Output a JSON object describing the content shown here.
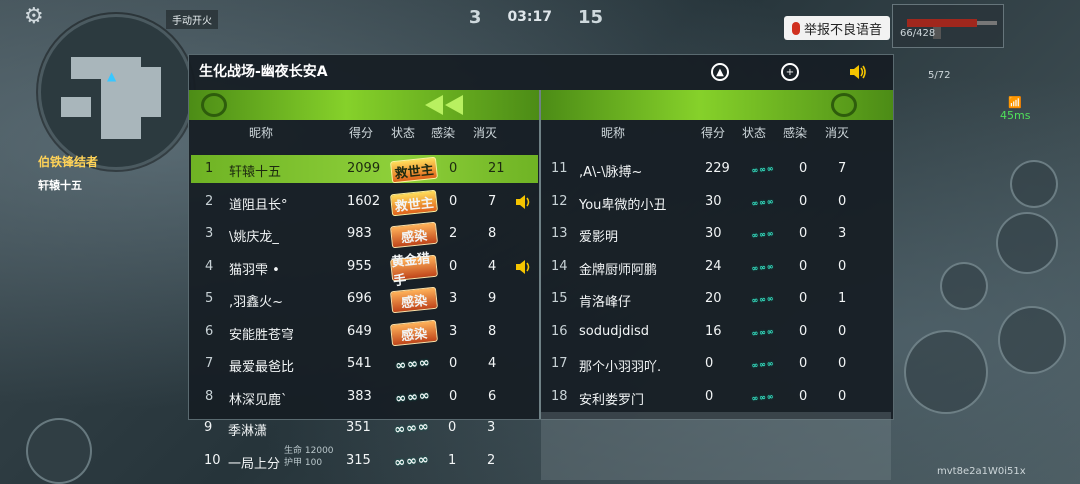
{
  "hud": {
    "auto_fire": "手动开火",
    "score_left": "3",
    "timer": "03:17",
    "score_right": "15",
    "report_label": "举报不良语音",
    "ammo_main": "66/428",
    "ammo_secondary": "5/72",
    "ping": "45ms",
    "hp_label": "生命",
    "armor_label": "护甲",
    "hp_value": "12000",
    "armor_value": "100",
    "uid": "mvt8e2a1W0i51x",
    "left_names": [
      "伯铁锋结者",
      "轩辕十五"
    ]
  },
  "board": {
    "title": "生化战场-幽夜长安A",
    "headers": {
      "name": "昵称",
      "score": "得分",
      "status": "状态",
      "infect": "感染",
      "kill": "消灭"
    },
    "left_rows": [
      {
        "num": "1",
        "name": "轩辕十五",
        "score": "2099",
        "badge": "救世主",
        "infect": "0",
        "kill": "21",
        "highlight": true,
        "speaker": false
      },
      {
        "num": "2",
        "name": "道阻且长°",
        "score": "1602",
        "badge": "救世主",
        "infect": "0",
        "kill": "7",
        "highlight": false,
        "speaker": true
      },
      {
        "num": "3",
        "name": "\\姚庆龙_",
        "score": "983",
        "badge": "感染",
        "infect": "2",
        "kill": "8",
        "highlight": false,
        "speaker": false
      },
      {
        "num": "4",
        "name": "猫羽雫 •",
        "score": "955",
        "badge": "黄金猎手",
        "infect": "0",
        "kill": "4",
        "highlight": false,
        "speaker": true
      },
      {
        "num": "5",
        "name": ",羽鑫火~",
        "score": "696",
        "badge": "感染",
        "infect": "3",
        "kill": "9",
        "highlight": false,
        "speaker": false
      },
      {
        "num": "6",
        "name": "安能胜苍穹",
        "score": "649",
        "badge": "感染",
        "infect": "3",
        "kill": "8",
        "highlight": false,
        "speaker": false
      },
      {
        "num": "7",
        "name": "最爱最爸比",
        "score": "541",
        "badge": "幽灵",
        "infect": "0",
        "kill": "4",
        "highlight": false,
        "speaker": false
      },
      {
        "num": "8",
        "name": "林深见鹿`",
        "score": "383",
        "badge": "幽灵",
        "infect": "0",
        "kill": "6",
        "highlight": false,
        "speaker": false
      },
      {
        "num": "9",
        "name": "季淋潇",
        "score": "351",
        "badge": "幽灵",
        "infect": "0",
        "kill": "3",
        "highlight": false,
        "speaker": false
      },
      {
        "num": "10",
        "name": "一局上分",
        "score": "315",
        "badge": "幽灵",
        "infect": "1",
        "kill": "2",
        "highlight": false,
        "speaker": false
      }
    ],
    "right_rows": [
      {
        "num": "11",
        "name": ",A\\-\\脉搏~",
        "score": "229",
        "badge": "幽灵",
        "infect": "0",
        "kill": "7"
      },
      {
        "num": "12",
        "name": "You卑微的小丑",
        "score": "30",
        "badge": "幽灵",
        "infect": "0",
        "kill": "0"
      },
      {
        "num": "13",
        "name": "爱影明",
        "score": "30",
        "badge": "幽灵",
        "infect": "0",
        "kill": "3"
      },
      {
        "num": "14",
        "name": "金牌厨师阿鹏",
        "score": "24",
        "badge": "幽灵",
        "infect": "0",
        "kill": "0"
      },
      {
        "num": "15",
        "name": "肯洛峰仔",
        "score": "20",
        "badge": "幽灵",
        "infect": "0",
        "kill": "1"
      },
      {
        "num": "16",
        "name": "sodudjdisd",
        "score": "16",
        "badge": "幽灵",
        "infect": "0",
        "kill": "0"
      },
      {
        "num": "17",
        "name": "那个小羽羽吖.",
        "score": "0",
        "badge": "幽灵",
        "infect": "0",
        "kill": "0"
      },
      {
        "num": "18",
        "name": "安利娄罗门",
        "score": "0",
        "badge": "幽灵",
        "infect": "0",
        "kill": "0"
      }
    ]
  },
  "icons": {
    "gear": "gear-icon",
    "mic": "mic-icon",
    "team_icon": "team-icon",
    "add_friend": "add-friend-icon",
    "speaker": "speaker-icon",
    "hazard": "biohazard-icon"
  },
  "colors": {
    "highlight": "#8ed03a",
    "team_bar": "#86d12a",
    "speaker": "#f5c400",
    "badge_teal": "#39e6c8"
  }
}
